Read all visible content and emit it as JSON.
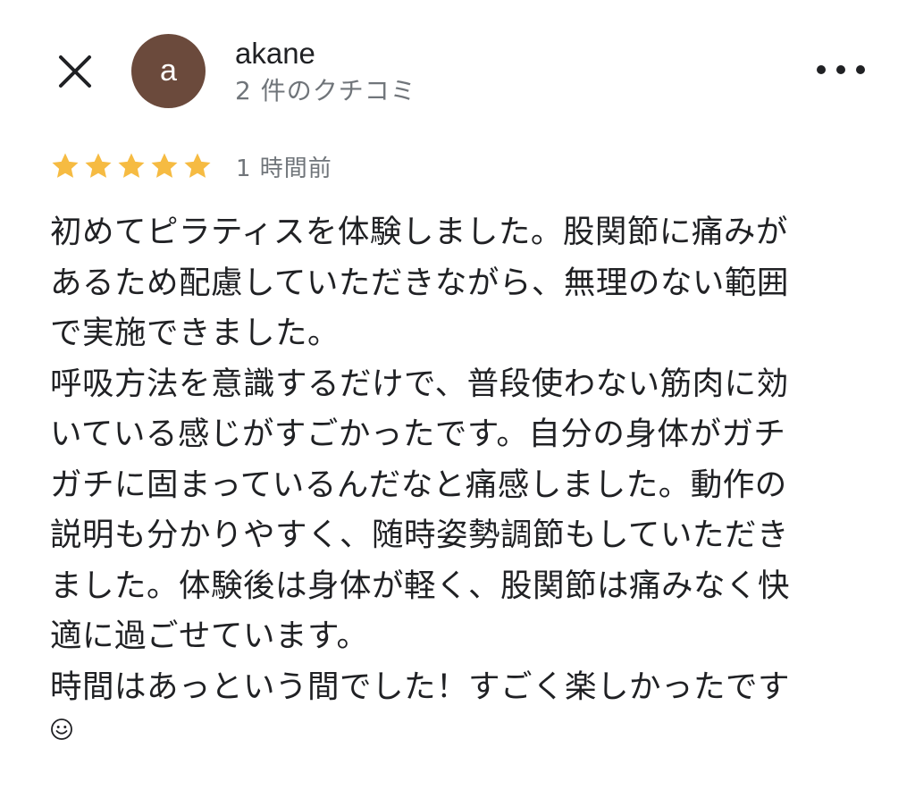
{
  "header": {
    "close_icon": "close-icon",
    "more_icon": "more-options-icon"
  },
  "user": {
    "avatar_letter": "a",
    "avatar_color": "#6b4a3c",
    "name": "akane",
    "review_count": "2 件のクチコミ"
  },
  "review": {
    "rating": 5,
    "max_rating": 5,
    "star_color": "#f6bb42",
    "time_ago": "1 時間前",
    "lines": [
      "初めてピラティスを体験しました。股関節に痛みが",
      "あるため配慮していただきながら、無理のない範囲",
      "で実施できました。",
      "呼吸方法を意識するだけで、普段使わない筋肉に効",
      "いている感じがすごかったです。自分の身体がガチ",
      "ガチに固まっているんだなと痛感しました。動作の",
      "説明も分かりやすく、随時姿勢調節もしていただき",
      "ました。体験後は身体が軽く、股関節は痛みなく快",
      "適に過ごせています。",
      "時間はあっという間でした！すごく楽しかったです"
    ],
    "trailing_emoji": "smiling-face-icon"
  }
}
